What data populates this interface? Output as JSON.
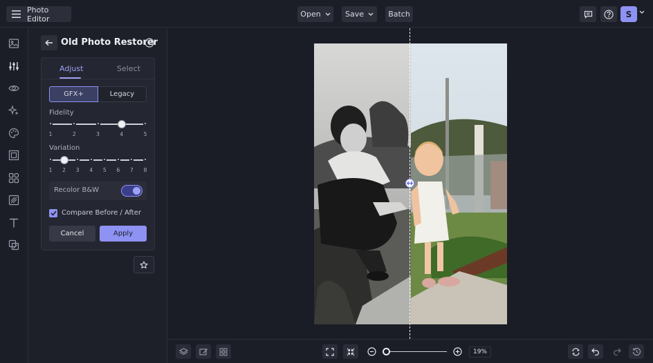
{
  "topbar": {
    "app_title": "Photo Editor",
    "open_label": "Open",
    "save_label": "Save",
    "batch_label": "Batch",
    "avatar_initial": "S"
  },
  "rail": {
    "icons": [
      "image-icon",
      "adjust-sliders-icon",
      "eye-icon",
      "effects-sparkle-icon",
      "palette-icon",
      "frame-icon",
      "overlays-icon",
      "textures-icon",
      "text-icon",
      "graphics-icon"
    ],
    "active_index": 1
  },
  "panel": {
    "title": "Old Photo Restorer",
    "tabs": [
      {
        "label": "Adjust",
        "active": true
      },
      {
        "label": "Select",
        "active": false
      }
    ],
    "modes": [
      {
        "label": "GFX+",
        "active": true
      },
      {
        "label": "Legacy",
        "active": false
      }
    ],
    "fidelity": {
      "label": "Fidelity",
      "min": 1,
      "max": 5,
      "value": 4,
      "ticks": [
        "1",
        "2",
        "3",
        "4",
        "5"
      ]
    },
    "variation": {
      "label": "Variation",
      "min": 1,
      "max": 8,
      "value": 2,
      "ticks": [
        "1",
        "2",
        "3",
        "4",
        "5",
        "6",
        "7",
        "8"
      ]
    },
    "recolor": {
      "label": "Recolor B&W",
      "on": true
    },
    "compare": {
      "label": "Compare Before / After",
      "checked": true
    },
    "cancel_label": "Cancel",
    "apply_label": "Apply"
  },
  "bottombar": {
    "zoom_text": "19%",
    "zoom_percent": 19
  },
  "colors": {
    "accent": "#8e92f2",
    "background": "#1b1d26",
    "panel": "#242631"
  }
}
